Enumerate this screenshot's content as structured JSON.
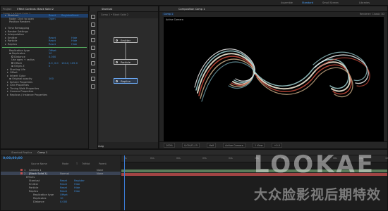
{
  "topbar": {
    "workspaces": [
      "Assemble",
      "Standard",
      "Small Screen",
      "Libraries"
    ]
  },
  "effect_panel": {
    "tabs": [
      "Project",
      "Effect Controls: Black Solid 2"
    ],
    "breadcrumb": "Comp 1 • Black Solid 2",
    "rows": [
      {
        "label": "Stardust",
        "v1": "Reset",
        "v2": "Register",
        "v3": "About",
        "kind": "fx",
        "indent": 1
      },
      {
        "label": "Node: Click to open",
        "v1": "Open",
        "kind": "plain",
        "indent": 3
      },
      {
        "label": "Position Renders",
        "kind": "plain",
        "indent": 3
      },
      {
        "label": "",
        "kind": "gap",
        "indent": 0
      },
      {
        "label": "Time Remapping",
        "kind": "group",
        "indent": 1
      },
      {
        "label": "Render Settings",
        "kind": "group",
        "indent": 1
      },
      {
        "label": "Interpolation",
        "kind": "group",
        "indent": 1
      },
      {
        "label": "Emitter",
        "v1": "Reset",
        "v3": "Hide",
        "kind": "group",
        "indent": 1
      },
      {
        "label": "Particle",
        "v1": "Reset",
        "v3": "Hide",
        "kind": "group",
        "indent": 1
      },
      {
        "label": "Replica",
        "v1": "Reset",
        "v3": "Hide",
        "kind": "group",
        "indent": 1
      },
      {
        "label": "",
        "kind": "green",
        "indent": 0
      },
      {
        "label": "Replication type",
        "v1": "Offset",
        "kind": "plain",
        "indent": 3
      },
      {
        "label": "Replicates",
        "v1": "10",
        "kind": "stop",
        "indent": 3
      },
      {
        "label": "Distance",
        "v1": "0.000",
        "kind": "stop",
        "indent": 4
      },
      {
        "label": "Use ages + radius",
        "v1": "",
        "kind": "plain",
        "indent": 4
      },
      {
        "label": "Offset",
        "v1": "0.0,  0.0",
        "v2": "104.0, 105.0",
        "kind": "stop",
        "indent": 4
      },
      {
        "label": "Origin Z",
        "v1": "0",
        "kind": "stop",
        "indent": 4
      },
      {
        "label": "Starting Life",
        "kind": "group",
        "indent": 2
      },
      {
        "label": "Offset",
        "kind": "group",
        "indent": 2
      },
      {
        "label": "Inherit Color",
        "kind": "group",
        "indent": 2
      },
      {
        "label": "Original opacity",
        "v1": "100",
        "kind": "stop",
        "indent": 3
      },
      {
        "label": "Sphere Properties",
        "kind": "group",
        "indent": 2
      },
      {
        "label": "Grid Properties",
        "kind": "group",
        "indent": 2
      },
      {
        "label": "Timing Walk Properties",
        "kind": "group",
        "indent": 2
      },
      {
        "label": "Camera Properties",
        "kind": "group",
        "indent": 2
      },
      {
        "label": "Replicas / Instance Properties",
        "kind": "group",
        "indent": 2
      }
    ]
  },
  "node_panel": {
    "tab": "Stardust",
    "breadcrumb": "Comp 1 • Black Solid 2",
    "nodes": [
      "Emitter",
      "Particle",
      "Replica"
    ],
    "footer": "fast mag"
  },
  "comp_panel": {
    "tab": "Composition Comp 1",
    "subtab": "Comp 1",
    "renderer": "Renderer: Classic 3D",
    "view_label": "Active Camera",
    "viewer_bar": [
      "100%",
      "0;00;02;15",
      "Half",
      "Active Camera",
      "1 View",
      "+0.0"
    ]
  },
  "timeline": {
    "tabs": [
      "Stardust Replica",
      "Comp 1"
    ],
    "timecode": "0;00;00;00",
    "columns": [
      "Source Name",
      "Mode",
      "T",
      "TrkMat",
      "Parent"
    ],
    "layers": [
      {
        "num": "1",
        "name": "Camera 1",
        "mode": "",
        "parent": "None",
        "color": "#b44a4a"
      },
      {
        "num": "2",
        "name": "[Black Solid 2]",
        "mode": "Normal",
        "parent": "None",
        "color": "#c74f4f",
        "selected": true
      }
    ],
    "subrows": [
      {
        "label": "Effects",
        "v1": "",
        "v2": ""
      },
      {
        "label": "Stardust",
        "v1": "Reset",
        "v2": "Register"
      },
      {
        "label": "Emitter",
        "v1": "Reset",
        "v2": "Hide"
      },
      {
        "label": "Particle",
        "v1": "Reset",
        "v2": "Hide"
      },
      {
        "label": "Replica",
        "v1": "Reset",
        "v2": "Hide"
      },
      {
        "label": "Replication type",
        "v1": "Offset",
        "v2": ""
      },
      {
        "label": "Replicates",
        "v1": "10",
        "v2": ""
      },
      {
        "label": "Distance",
        "v1": "0.000",
        "v2": ""
      }
    ],
    "ticks": [
      "0s",
      "01s",
      "02s",
      "03s",
      "04s",
      "05s",
      "06s",
      "07s",
      "08s",
      "09s",
      "10s"
    ]
  },
  "watermark": {
    "line1": "LOOKAE",
    "line2": "大众脸影视后期特效"
  },
  "colors": {
    "accent": "#3d8cd9",
    "panel": "#232323",
    "green_bar": "#4e8e4a",
    "red_bar": "#a24444",
    "timeline_bar": "#4a6a5a"
  }
}
